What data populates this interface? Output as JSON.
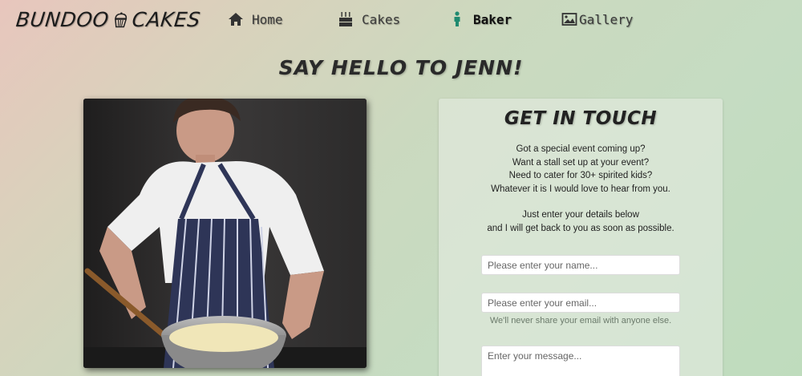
{
  "brand": {
    "left": "BUNDOO",
    "right": "CAKES",
    "icon": "cupcake-icon"
  },
  "nav": {
    "items": [
      {
        "label": "Home",
        "icon": "home-icon"
      },
      {
        "label": "Cakes",
        "icon": "birthday-cake-icon"
      },
      {
        "label": "Baker",
        "icon": "person-icon",
        "active": true
      },
      {
        "label": "Gallery",
        "icon": "image-icon"
      }
    ]
  },
  "page": {
    "heading": "SAY HELLO TO JENN!"
  },
  "contact": {
    "title": "GET IN TOUCH",
    "intro": [
      "Got a special event coming up?",
      "Want a stall set up at your event?",
      "Need to cater for 30+ spirited kids?",
      "Whatever it is I would love to hear from you."
    ],
    "instructions": [
      "Just enter your details below",
      "and I will get back to you as soon as possible."
    ],
    "name_placeholder": "Please enter your name...",
    "email_placeholder": "Please enter your email...",
    "email_help": "We'll never share your email with anyone else.",
    "message_placeholder": "Enter your message..."
  },
  "colors": {
    "accent": "#1f8a70",
    "text": "#222222"
  }
}
